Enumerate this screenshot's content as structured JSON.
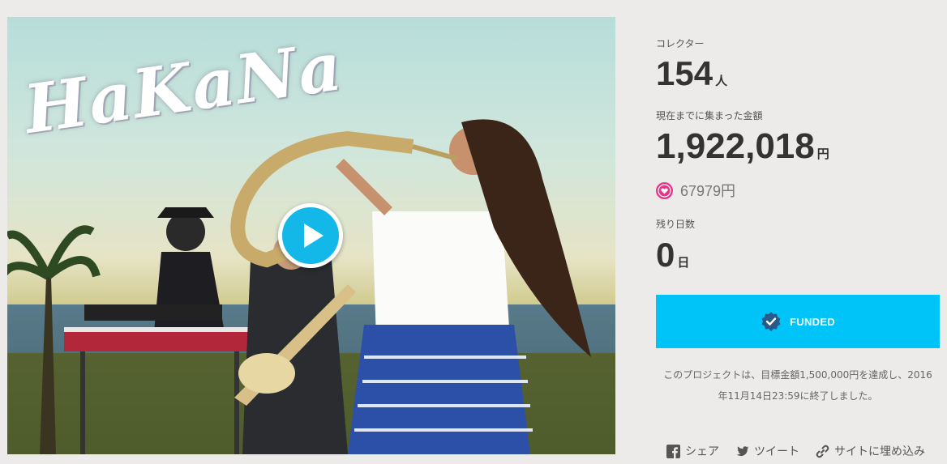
{
  "video": {
    "logo_text": "HaKaNa",
    "play_icon": "play-icon"
  },
  "stats": {
    "collector_label": "コレクター",
    "collector_value": "154",
    "collector_unit": "人",
    "amount_label": "現在までに集まった金額",
    "amount_value": "1,922,018",
    "amount_unit": "円",
    "yell_value": "67979円",
    "remaining_label": "残り日数",
    "remaining_value": "0",
    "remaining_unit": "日"
  },
  "status": {
    "funded_label": "FUNDED",
    "note_line1": "このプロジェクトは、目標金額1,500,000円を達成し、2016",
    "note_line2": "年11月14日23:59に終了しました。"
  },
  "share": {
    "facebook_label": "シェア",
    "twitter_label": "ツイート",
    "embed_label": "サイトに埋め込み"
  },
  "colors": {
    "accent": "#00c3f8",
    "play": "#14b8e8",
    "yell": "#e8338a",
    "background": "#ecebe9"
  }
}
